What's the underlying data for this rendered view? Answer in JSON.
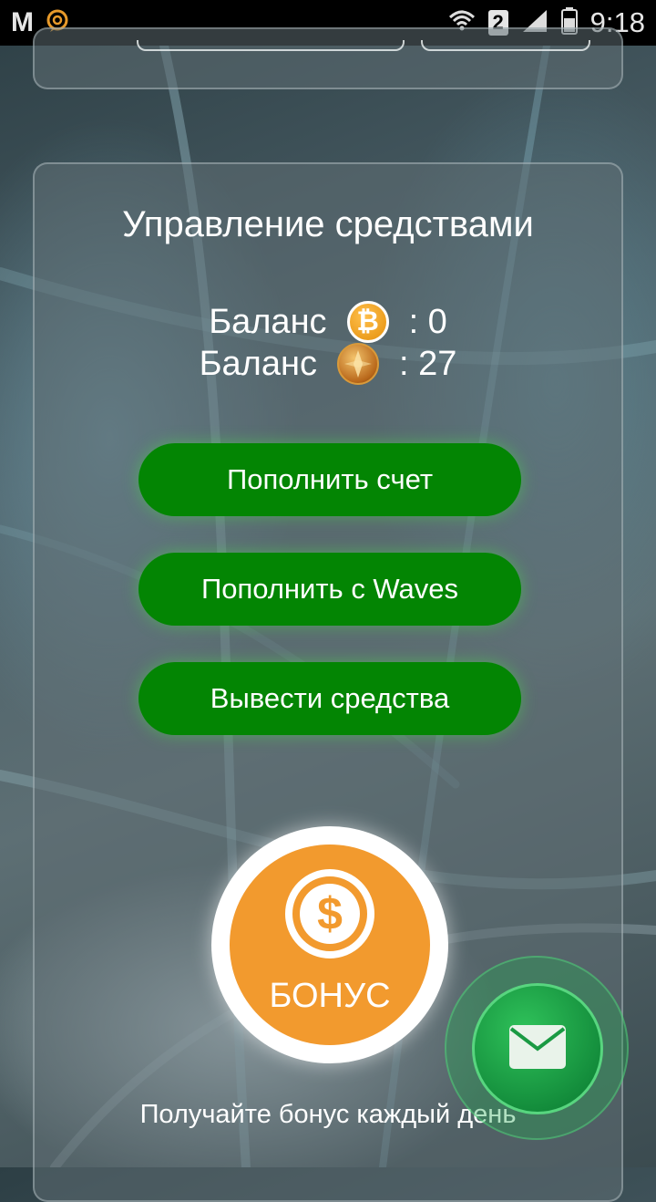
{
  "status_bar": {
    "left_letter": "M",
    "sim_slot": "2",
    "time": "9:18",
    "icons": [
      "gmail-icon",
      "chat-app-icon",
      "wifi-icon",
      "sim-2-icon",
      "signal-icon",
      "battery-icon"
    ]
  },
  "funds": {
    "title": "Управление средствами",
    "balance_btc_label": "Баланс",
    "balance_btc_value": ": 0",
    "balance_token_label": "Баланс",
    "balance_token_value": ": 27",
    "buttons": {
      "top_up": "Пополнить счет",
      "top_up_waves": "Пополнить с Waves",
      "withdraw": "Вывести средства"
    }
  },
  "bonus": {
    "label": "БОНУС",
    "caption": "Получайте бонус каждый день"
  },
  "colors": {
    "button_green": "#038503",
    "bonus_orange": "#f29a2e",
    "fab_green": "#1fa84a"
  }
}
